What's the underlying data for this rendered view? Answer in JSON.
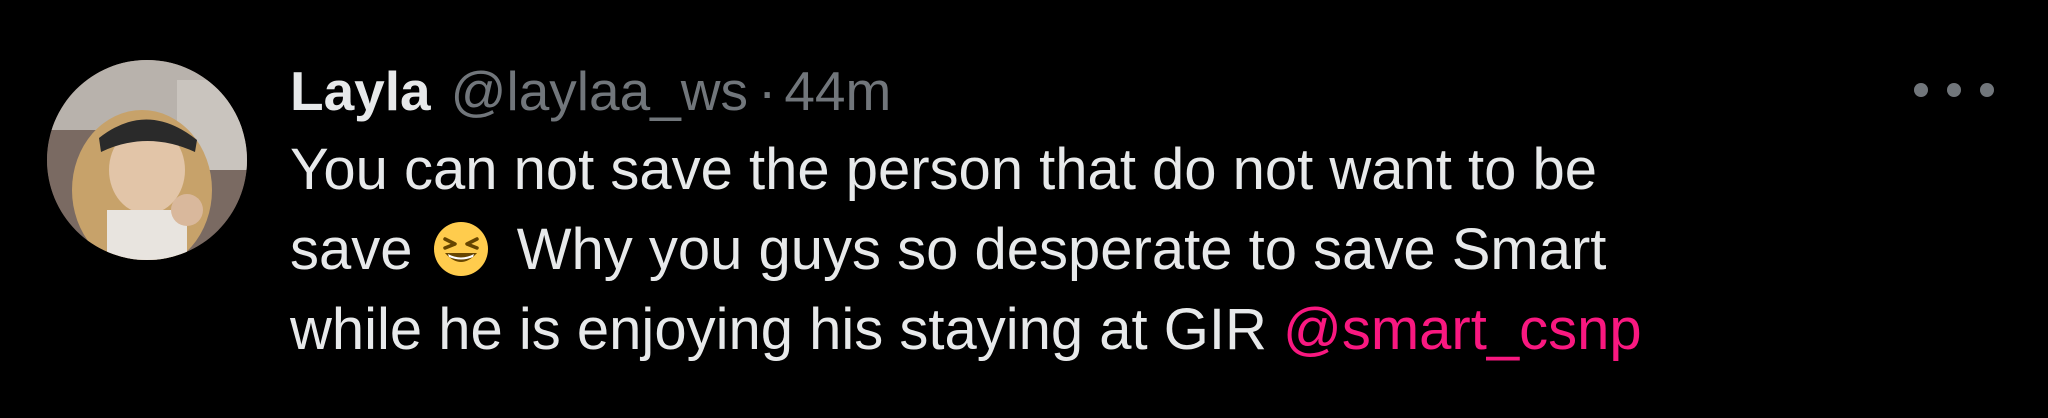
{
  "tweet": {
    "author": {
      "display_name": "Layla",
      "handle": "@laylaa_ws"
    },
    "separator": "·",
    "time": "44m",
    "text": {
      "line1": "You can not save the person that do not want to be",
      "line2_before_emoji": "save",
      "emoji": "grinning-squinting-face-emoji",
      "line2_after_emoji": "Why you guys so desperate to save Smart",
      "line3_before_mention": "while he is enjoying his staying at GIR",
      "mention": "@smart_csnp"
    },
    "more_icon": "more-horizontal-icon"
  },
  "colors": {
    "background": "#000000",
    "text": "#e7e9ea",
    "secondary": "#71767b",
    "mention": "#f91880"
  }
}
